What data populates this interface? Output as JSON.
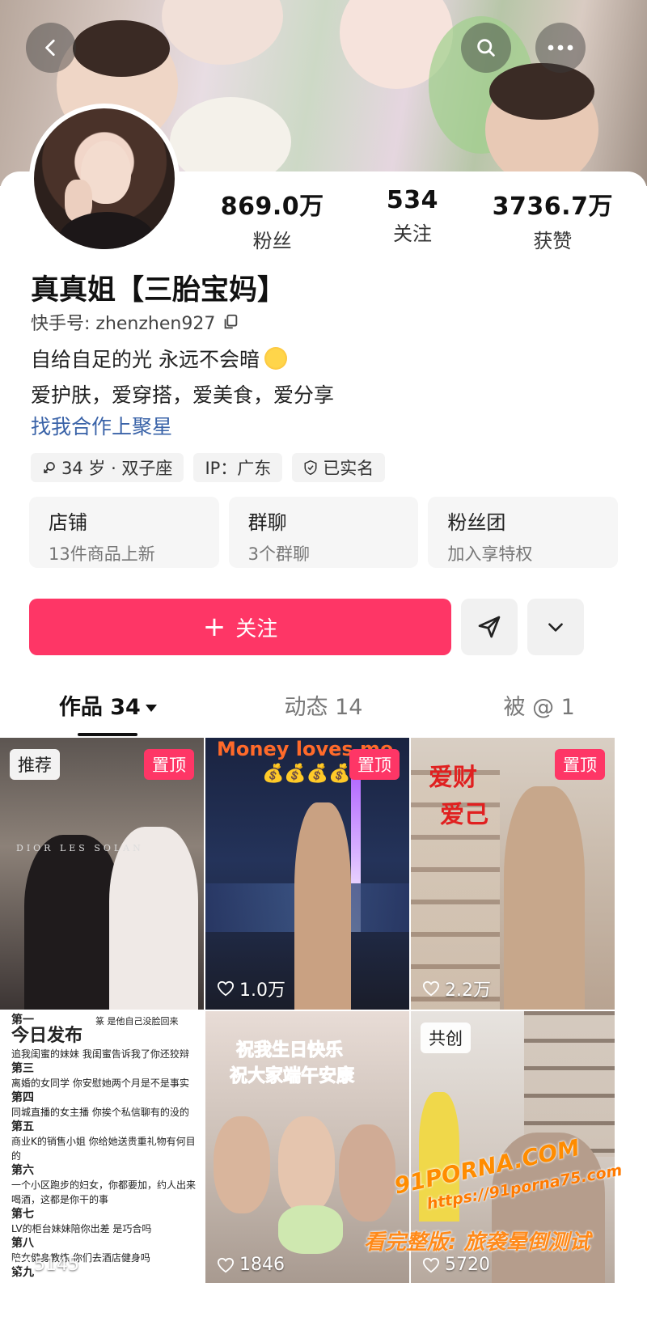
{
  "header": {
    "back_icon": "chevron-left-icon",
    "search_icon": "search-icon",
    "more_icon": "more-dots-icon"
  },
  "profile": {
    "name": "真真姐【三胎宝妈】",
    "id_label": "快手号: zhenzhen927",
    "bio_line1": "自给自足的光 永远不会暗",
    "bio_line2": "爱护肤，爱穿搭，爱美食，爱分享",
    "link": "找我合作上聚星",
    "stats": [
      {
        "value": "869.0万",
        "label": "粉丝"
      },
      {
        "value": "534",
        "label": "关注"
      },
      {
        "value": "3736.7万",
        "label": "获赞"
      }
    ],
    "tags": [
      "34 岁 · 双子座",
      "IP：广东",
      "已实名"
    ]
  },
  "features": [
    {
      "title": "店铺",
      "subtitle": "13件商品上新"
    },
    {
      "title": "群聊",
      "subtitle": "3个群聊"
    },
    {
      "title": "粉丝团",
      "subtitle": "加入享特权"
    }
  ],
  "actions": {
    "follow_label": "关注",
    "share_icon": "send-icon",
    "more_icon": "chevron-down-icon"
  },
  "tabs": [
    {
      "label": "作品 34"
    },
    {
      "label": "动态 14"
    },
    {
      "label": "被 @ 1"
    }
  ],
  "videos": [
    {
      "badge_left": "推荐",
      "badge_right": "置顶",
      "overlay": "DIOR LES SOLAN",
      "likes": ""
    },
    {
      "badge_right": "置顶",
      "overlay": "Money loves me",
      "overlay2": "💰💰💰💰",
      "likes": "1.0万"
    },
    {
      "badge_right": "置顶",
      "overlay": "爱财",
      "overlay2": "爱己",
      "likes": "2.2万"
    },
    {
      "heading": "第一",
      "big": "今日发布",
      "lines": [
        "追我闺蜜的妹妹 我闺蜜告诉我了你还狡辩",
        "第三",
        "离婚的女同学 你安慰她两个月是不是事实",
        "第四",
        "同城直播的女主播 你挨个私信聊有的没的",
        "第五",
        "商业K的销售小姐 你给她送贵重礼物有何目的",
        "第六",
        "一个小区跑步的妇女，你都要加，约人出来喝酒，这都是你干的事",
        "第七",
        "LV的柜台妹妹陪你出差 是巧合吗",
        "第八",
        "陪女健身教练 你们去酒店健身吗",
        "第九"
      ],
      "top_right": "篆 是他自己没脸回来",
      "likes": "5145"
    },
    {
      "overlay": "祝我生日快乐",
      "overlay2": "祝大家端午安康",
      "likes": "1846"
    },
    {
      "badge_left": "共创",
      "likes": "5720"
    }
  ],
  "watermark": {
    "line1": "91PORNA.COM",
    "line2": "https://91porna75.com",
    "line3": "看完整版: 旅袭晕倒测试"
  },
  "colors": {
    "accent": "#fe3666",
    "link": "#3a63a8"
  }
}
